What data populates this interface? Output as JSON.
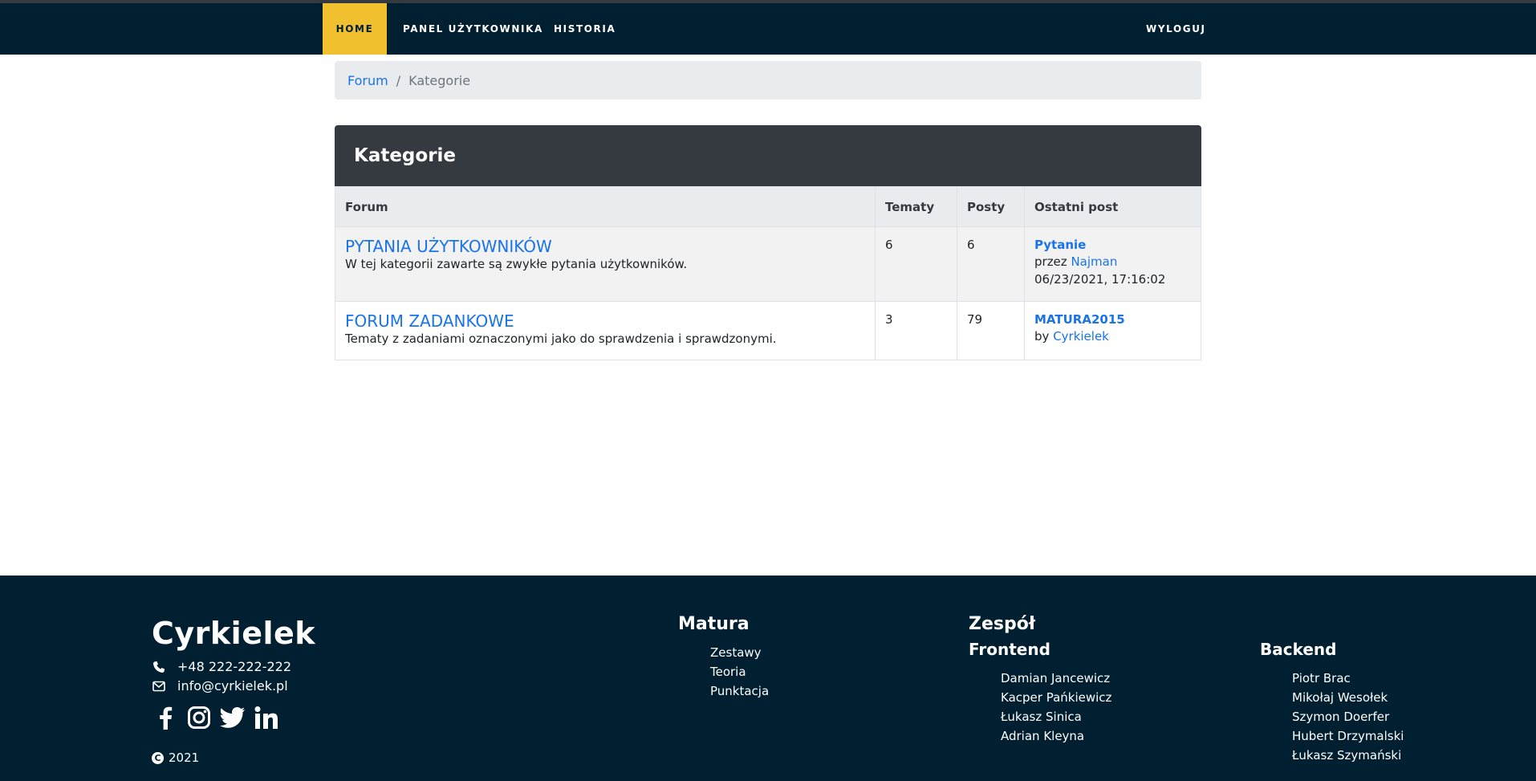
{
  "nav": {
    "home": "HOME",
    "panel": "PANEL UŻYTKOWNIKA",
    "historia": "HISTORIA",
    "logout": "WYLOGUJ",
    "active_color": "#f0c02f",
    "bg_color": "#001f30"
  },
  "breadcrumb": {
    "root": "Forum",
    "separator": "/",
    "current": "Kategorie"
  },
  "card": {
    "title": "Kategorie",
    "columns": [
      "Forum",
      "Tematy",
      "Posty",
      "Ostatni post"
    ],
    "rows": [
      {
        "title": "PYTANIA UŻYTKOWNIKÓW",
        "description": "W tej kategorii zawarte są zwykłe pytania użytkowników.",
        "topics": "6",
        "posts": "6",
        "last_post": {
          "title": "Pytanie",
          "by_label": "przez",
          "user": "Najman",
          "date": "06/23/2021, 17:16:02"
        }
      },
      {
        "title": "FORUM ZADANKOWE",
        "description": "Tematy z zadaniami oznaczonymi jako do sprawdzenia i sprawdzonymi.",
        "topics": "3",
        "posts": "79",
        "last_post": {
          "title": "MATURA2015",
          "by_label": "by",
          "user": "Cyrkielek"
        }
      }
    ]
  },
  "footer": {
    "brand": "Cyrkielek",
    "phone": "+48 222-222-222",
    "email": "info@cyrkielek.pl",
    "socials": [
      "facebook-icon",
      "instagram-icon",
      "twitter-icon",
      "linkedin-icon"
    ],
    "copyright": "2021",
    "matura": {
      "heading": "Matura",
      "links": [
        "Zestawy",
        "Teoria",
        "Punktacja"
      ]
    },
    "team": {
      "heading": "Zespół",
      "frontend": {
        "heading": "Frontend",
        "members": [
          "Damian Jancewicz",
          "Kacper Pańkiewicz",
          "Łukasz Sinica",
          "Adrian Kleyna"
        ]
      },
      "backend": {
        "heading": "Backend",
        "members": [
          "Piotr Brac",
          "Mikołaj Wesołek",
          "Szymon Doerfer",
          "Hubert Drzymalski",
          "Łukasz Szymański"
        ]
      }
    }
  }
}
